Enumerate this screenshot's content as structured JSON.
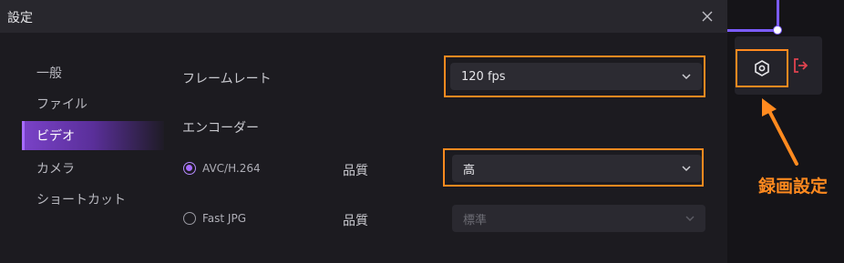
{
  "dialog": {
    "title": "設定"
  },
  "sidebar": {
    "items": [
      {
        "label": "一般",
        "active": false
      },
      {
        "label": "ファイル",
        "active": false
      },
      {
        "label": "ビデオ",
        "active": true
      },
      {
        "label": "カメラ",
        "active": false
      },
      {
        "label": "ショートカット",
        "active": false
      }
    ]
  },
  "video": {
    "framerate_label": "フレームレート",
    "framerate_value": "120 fps",
    "encoder_label": "エンコーダー",
    "encoders": [
      {
        "name": "AVC/H.264",
        "selected": true,
        "quality_label": "品質",
        "quality_value": "高",
        "enabled": true
      },
      {
        "name": "Fast JPG",
        "selected": false,
        "quality_label": "品質",
        "quality_value": "標準",
        "enabled": false
      }
    ]
  },
  "annotation": {
    "text": "録画設定",
    "color": "#ff8a1f"
  },
  "colors": {
    "accent": "#7a42c8",
    "highlight": "#ff8a1f",
    "exit_icon": "#e0434f"
  },
  "icons": [
    "close-icon",
    "chevron-down-icon",
    "hexagon-settings-icon",
    "exit-icon"
  ]
}
